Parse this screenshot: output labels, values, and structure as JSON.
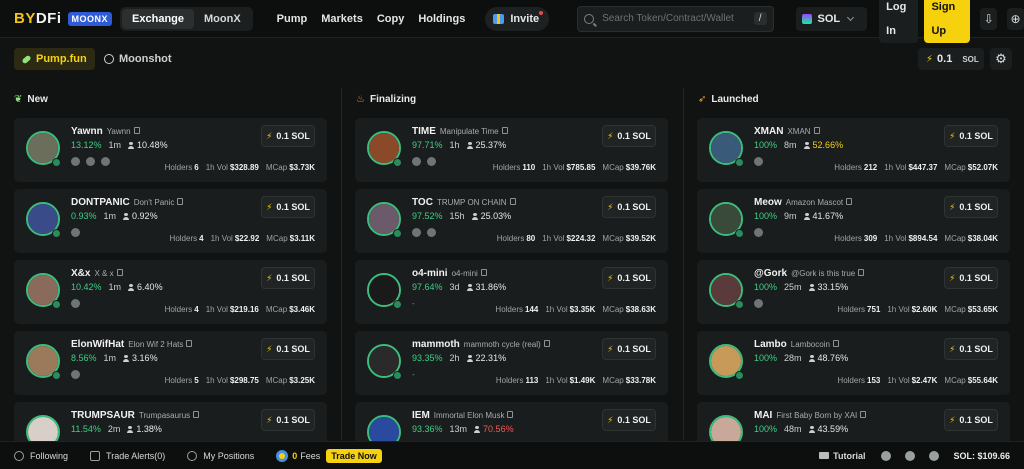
{
  "header": {
    "logo_text_1": "BY",
    "logo_text_2": "DFi",
    "logo_badge": "MOONX",
    "switch_exchange": "Exchange",
    "switch_moonx": "MoonX",
    "nav": [
      "Pump",
      "Markets",
      "Copy",
      "Holdings"
    ],
    "invite": "Invite",
    "search_placeholder": "Search Token/Contract/Wallet",
    "search_shortcut": "/",
    "chain": "SOL",
    "login": "Log In",
    "signup": "Sign Up"
  },
  "subbar": {
    "pump": "Pump.fun",
    "moonshot": "Moonshot",
    "quick_buy_value": "0.1",
    "quick_buy_unit": "SOL"
  },
  "columns": {
    "new": "New",
    "finalizing": "Finalizing",
    "launched": "Launched"
  },
  "labels": {
    "holders": "Holders",
    "vol": "1h Vol",
    "mcap": "MCap",
    "buy": "0.1 SOL"
  },
  "cards": {
    "new": [
      {
        "ticker": "Yawnn",
        "name": "Yawnn",
        "pct": "13.12%",
        "age": "1m",
        "holders_pct": "10.48%",
        "holders": "6",
        "vol": "$328.89",
        "mcap": "$3.73K",
        "socials": 3,
        "avatar": "#6a6e5a"
      },
      {
        "ticker": "DONTPANIC",
        "name": "Don't Panic",
        "pct": "0.93%",
        "age": "1m",
        "holders_pct": "0.92%",
        "holders": "4",
        "vol": "$22.92",
        "mcap": "$3.11K",
        "socials": 1,
        "avatar": "#3a4b8a"
      },
      {
        "ticker": "X&x",
        "name": "X & x",
        "pct": "10.42%",
        "age": "1m",
        "holders_pct": "6.40%",
        "holders": "4",
        "vol": "$219.16",
        "mcap": "$3.46K",
        "socials": 1,
        "avatar": "#8a6a5a"
      },
      {
        "ticker": "ElonWifHat",
        "name": "Elon Wif 2 Hats",
        "pct": "8.56%",
        "age": "1m",
        "holders_pct": "3.16%",
        "holders": "5",
        "vol": "$298.75",
        "mcap": "$3.25K",
        "socials": 1,
        "avatar": "#9a7a5a"
      },
      {
        "ticker": "TRUMPSAUR",
        "name": "Trumpasaurus",
        "pct": "11.54%",
        "age": "2m",
        "holders_pct": "1.38%",
        "holders": "",
        "vol": "",
        "mcap": "",
        "socials": 0,
        "avatar": "#d8d0c8"
      }
    ],
    "finalizing": [
      {
        "ticker": "TIME",
        "name": "Manipulate Time",
        "pct": "97.71%",
        "age": "1h",
        "holders_pct": "25.37%",
        "holders": "110",
        "vol": "$785.85",
        "mcap": "$39.76K",
        "socials": 2,
        "avatar": "#8a4a2a"
      },
      {
        "ticker": "TOC",
        "name": "TRUMP ON CHAIN",
        "pct": "97.52%",
        "age": "15h",
        "holders_pct": "25.03%",
        "holders": "80",
        "vol": "$224.32",
        "mcap": "$39.52K",
        "socials": 2,
        "avatar": "#6a5a6a"
      },
      {
        "ticker": "o4-mini",
        "name": "o4-mini",
        "pct": "97.64%",
        "age": "3d",
        "holders_pct": "31.86%",
        "holders": "144",
        "vol": "$3.35K",
        "mcap": "$38.63K",
        "socials": 0,
        "avatar": "#1a1a1a"
      },
      {
        "ticker": "mammoth",
        "name": "mammoth cycle (real)",
        "pct": "93.35%",
        "age": "2h",
        "holders_pct": "22.31%",
        "holders": "113",
        "vol": "$1.49K",
        "mcap": "$33.78K",
        "socials": 0,
        "avatar": "#2a2a2a"
      },
      {
        "ticker": "IEM",
        "name": "Immortal Elon Musk",
        "pct": "93.36%",
        "age": "13m",
        "holders_pct": "70.56%",
        "holders": "",
        "vol": "",
        "mcap": "",
        "socials": 0,
        "avatar": "#2a4aa0"
      }
    ],
    "launched": [
      {
        "ticker": "XMAN",
        "name": "XMAN",
        "pct": "100%",
        "age": "8m",
        "holders_pct": "52.66%",
        "holders": "212",
        "vol": "$447.37",
        "mcap": "$52.07K",
        "socials": 1,
        "avatar": "#3a5a7a"
      },
      {
        "ticker": "Meow",
        "name": "Amazon Mascot",
        "pct": "100%",
        "age": "9m",
        "holders_pct": "41.67%",
        "holders": "309",
        "vol": "$894.54",
        "mcap": "$38.04K",
        "socials": 1,
        "avatar": "#3a4a3a"
      },
      {
        "ticker": "@Gork",
        "name": "@Gork is this true",
        "pct": "100%",
        "age": "25m",
        "holders_pct": "33.15%",
        "holders": "751",
        "vol": "$2.60K",
        "mcap": "$53.65K",
        "socials": 1,
        "avatar": "#5a3a3a"
      },
      {
        "ticker": "Lambo",
        "name": "Lambocoin",
        "pct": "100%",
        "age": "28m",
        "holders_pct": "48.76%",
        "holders": "153",
        "vol": "$2.47K",
        "mcap": "$55.64K",
        "socials": 0,
        "avatar": "#c89a5a"
      },
      {
        "ticker": "MAI",
        "name": "First Baby Born by XAI",
        "pct": "100%",
        "age": "48m",
        "holders_pct": "43.59%",
        "holders": "",
        "vol": "",
        "mcap": "",
        "socials": 0,
        "avatar": "#c8a898"
      }
    ]
  },
  "footer": {
    "following": "Following",
    "trade_alerts": "Trade Alerts(0)",
    "positions": "My Positions",
    "fees_num": "0",
    "fees": "Fees",
    "trade_now": "Trade Now",
    "tutorial": "Tutorial",
    "sol_price": "SOL: $109.66"
  },
  "colors": {
    "accent": "#f5d10e",
    "positive": "#3ecf86",
    "negative": "#ef5b5b"
  }
}
